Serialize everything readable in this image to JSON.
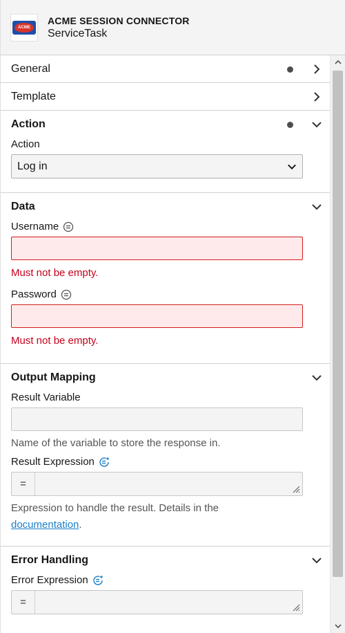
{
  "header": {
    "logo_text": "ACME",
    "title": "ACME SESSION CONNECTOR",
    "subtitle": "ServiceTask"
  },
  "groups": {
    "general": {
      "label": "General"
    },
    "template": {
      "label": "Template"
    }
  },
  "action_section": {
    "title": "Action",
    "field_label": "Action",
    "selected": "Log in"
  },
  "data_section": {
    "title": "Data",
    "username_label": "Username",
    "username_error": "Must not be empty.",
    "password_label": "Password",
    "password_error": "Must not be empty."
  },
  "output_section": {
    "title": "Output Mapping",
    "result_variable_label": "Result Variable",
    "result_variable_hint": "Name of the variable to store the response in.",
    "result_expression_label": "Result Expression",
    "feel_symbol": "=",
    "result_expression_hint_prefix": "Expression to handle the result. Details in the",
    "result_expression_link": "documentation",
    "result_expression_hint_suffix": "."
  },
  "error_section": {
    "title": "Error Handling",
    "error_expression_label": "Error Expression",
    "feel_symbol": "="
  },
  "colors": {
    "error": "#c4001a",
    "error_bg": "#feeaea",
    "link": "#1b7ec9",
    "feel_icon": "#1b7ec9"
  }
}
